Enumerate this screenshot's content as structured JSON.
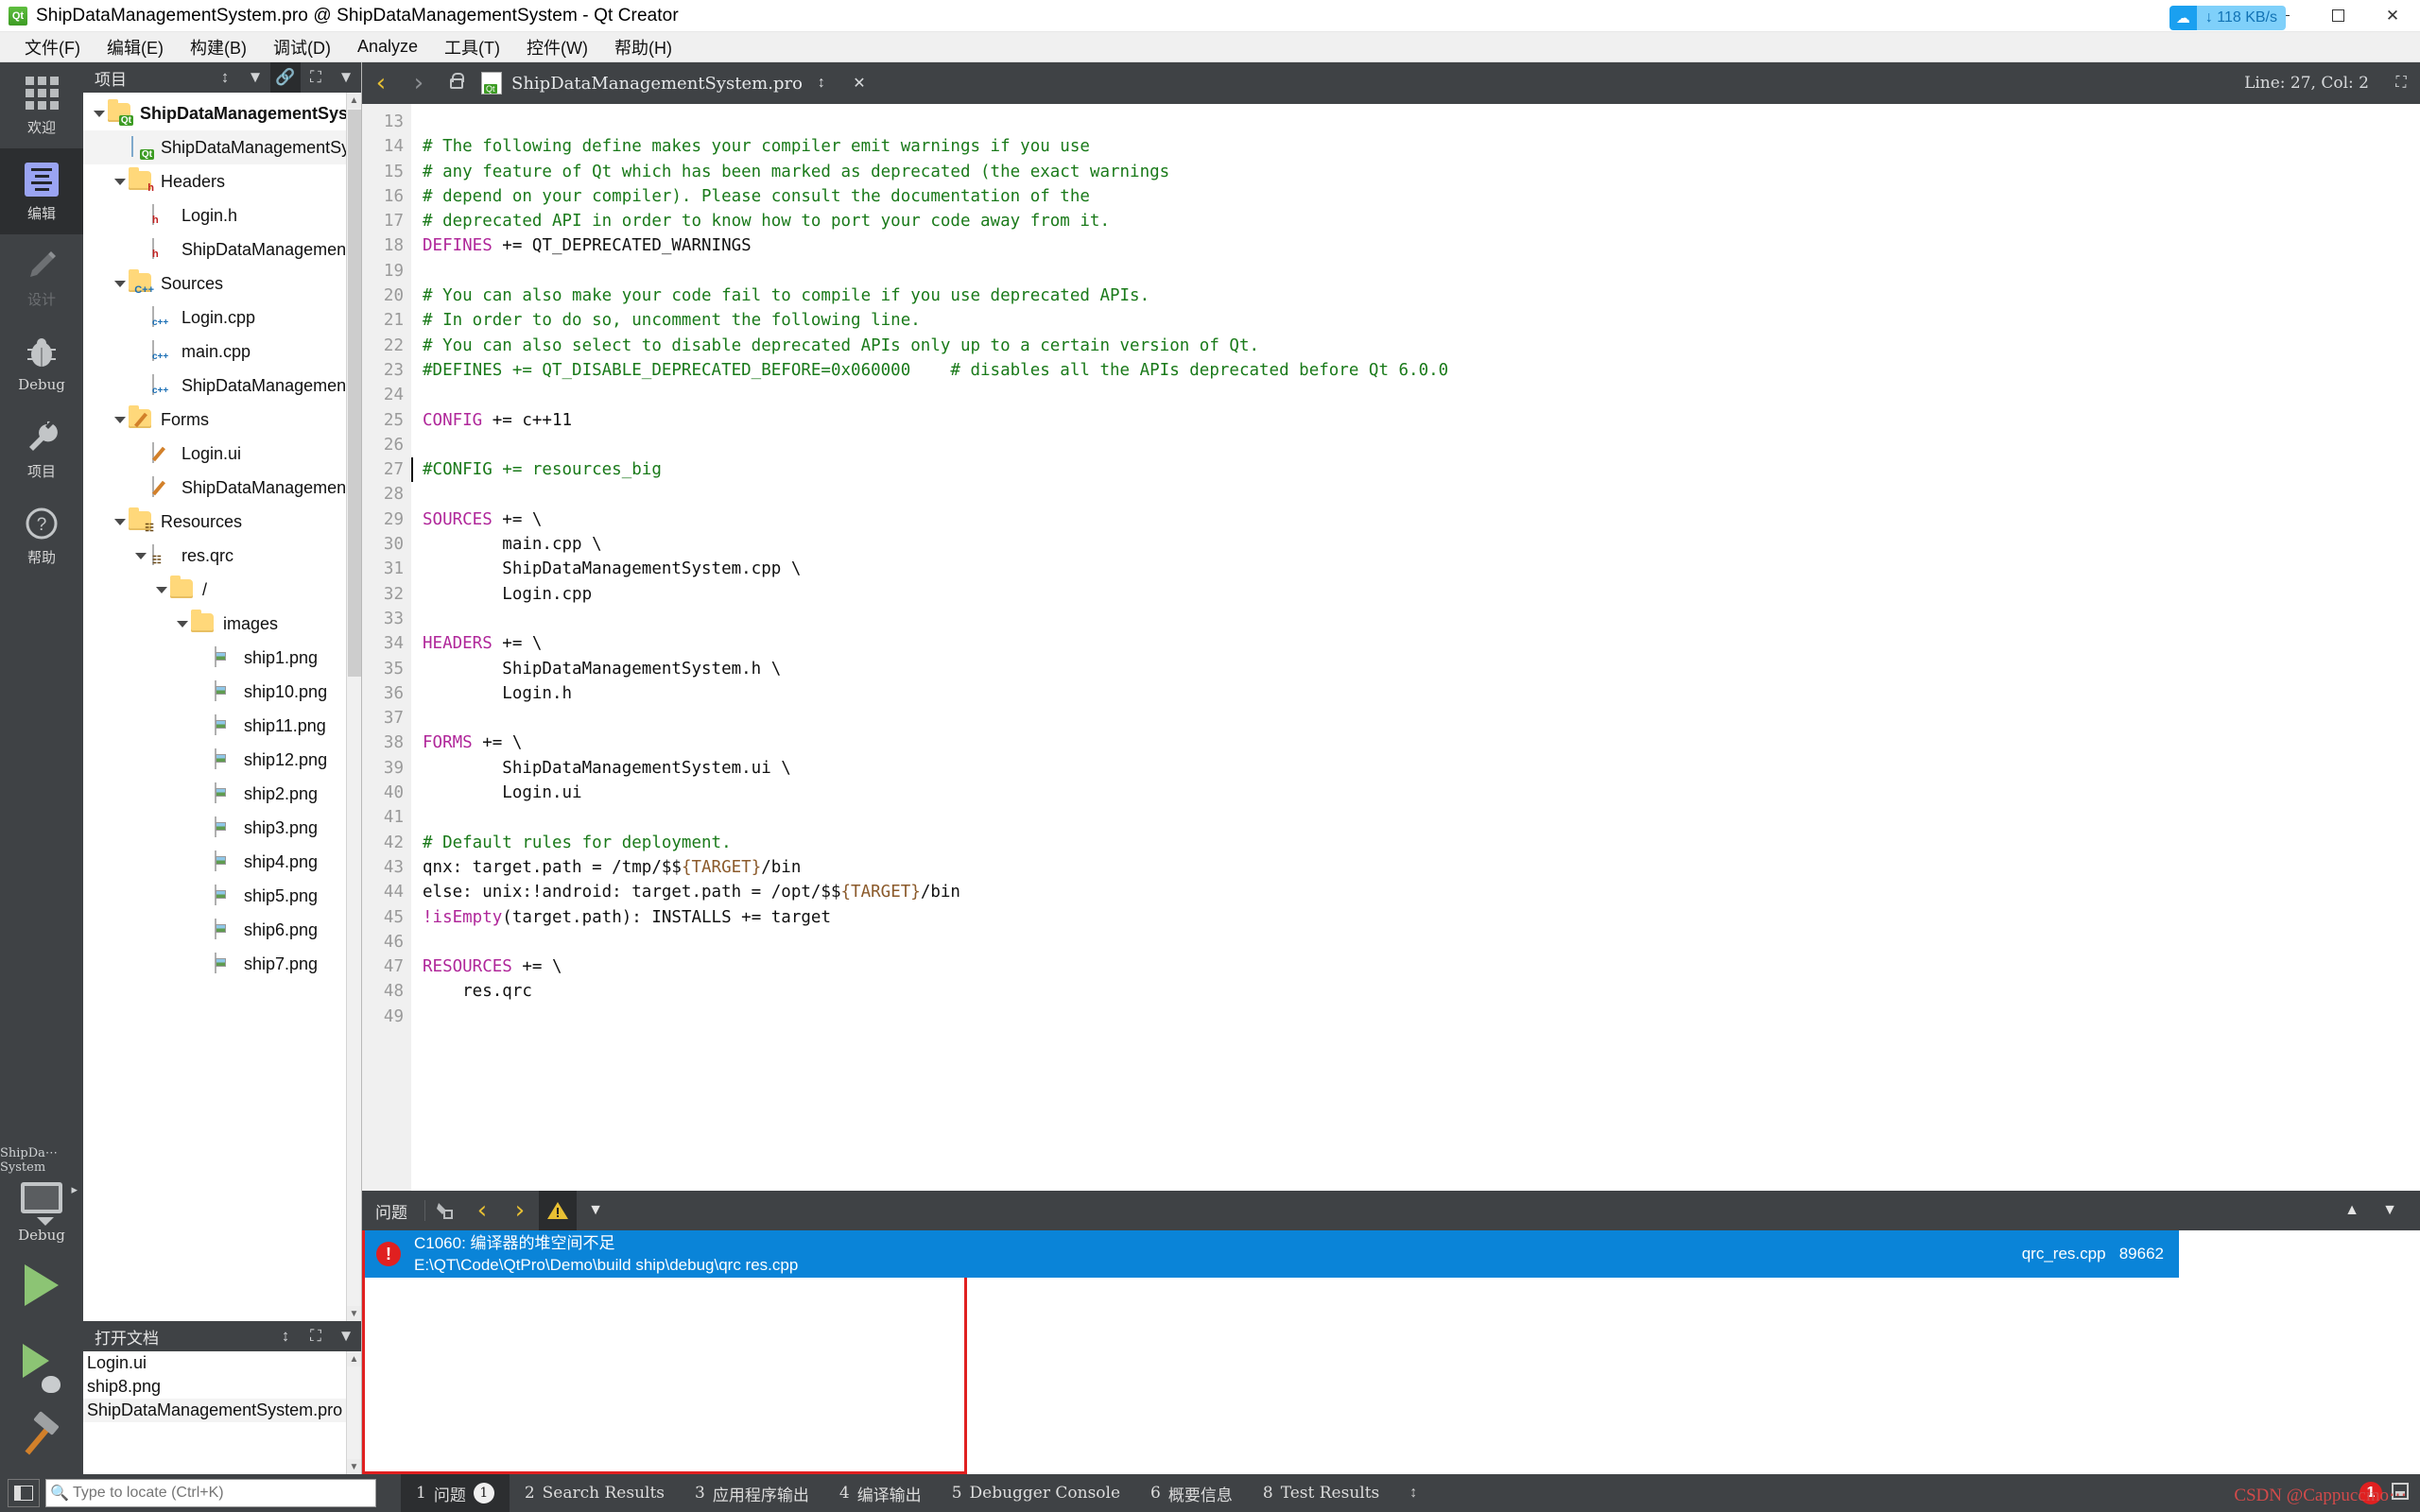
{
  "window": {
    "title": "ShipDataManagementSystem.pro @ ShipDataManagementSystem - Qt Creator",
    "app_icon": "qt-icon",
    "minimize": "–",
    "maximize": "▭",
    "close": "✕"
  },
  "menu": {
    "items": [
      "文件(F)",
      "编辑(E)",
      "构建(B)",
      "调试(D)",
      "Analyze",
      "工具(T)",
      "控件(W)",
      "帮助(H)"
    ]
  },
  "net_badge": {
    "icon": "cloud-icon",
    "speed": "↓ 118 KB/s"
  },
  "modebar": {
    "items": [
      {
        "label": "欢迎",
        "icon": "welcome-grid-icon",
        "state": "normal"
      },
      {
        "label": "编辑",
        "icon": "edit-lines-icon",
        "state": "active"
      },
      {
        "label": "设计",
        "icon": "design-pencil-icon",
        "state": "disabled"
      },
      {
        "label": "Debug",
        "icon": "debug-bug-icon",
        "state": "normal"
      },
      {
        "label": "项目",
        "icon": "projects-wrench-icon",
        "state": "normal"
      },
      {
        "label": "帮助",
        "icon": "help-question-icon",
        "state": "normal"
      }
    ],
    "kit": {
      "name": "ShipDa⋯System",
      "mode": "Debug",
      "icon": "monitor-icon"
    },
    "run": "run-play-button",
    "debug": "debug-play-button",
    "build": "build-hammer-button"
  },
  "project_dock": {
    "title": "项目",
    "tools": [
      "sync-icon",
      "filter-icon",
      "link-icon",
      "split-icon",
      "close-dock-icon"
    ],
    "tree": [
      {
        "label": "ShipDataManagementSystem",
        "icon": "qt-project-folder-icon",
        "indent": 0,
        "expanded": true,
        "bold": true
      },
      {
        "label": "ShipDataManagementSystem.pro",
        "icon": "qt-pro-file-icon",
        "indent": 1,
        "selected": true
      },
      {
        "label": "Headers",
        "icon": "headers-folder-icon",
        "indent": 1,
        "expanded": true
      },
      {
        "label": "Login.h",
        "icon": "h-file-icon",
        "indent": 2
      },
      {
        "label": "ShipDataManagementSystem.h",
        "icon": "h-file-icon",
        "indent": 2
      },
      {
        "label": "Sources",
        "icon": "sources-folder-icon",
        "indent": 1,
        "expanded": true
      },
      {
        "label": "Login.cpp",
        "icon": "cpp-file-icon",
        "indent": 2
      },
      {
        "label": "main.cpp",
        "icon": "cpp-file-icon",
        "indent": 2
      },
      {
        "label": "ShipDataManagementSystem.cpp",
        "icon": "cpp-file-icon",
        "indent": 2
      },
      {
        "label": "Forms",
        "icon": "forms-folder-icon",
        "indent": 1,
        "expanded": true
      },
      {
        "label": "Login.ui",
        "icon": "ui-file-icon",
        "indent": 2
      },
      {
        "label": "ShipDataManagementSystem.ui",
        "icon": "ui-file-icon",
        "indent": 2
      },
      {
        "label": "Resources",
        "icon": "resources-folder-icon",
        "indent": 1,
        "expanded": true
      },
      {
        "label": "res.qrc",
        "icon": "qrc-file-icon",
        "indent": 2,
        "expanded": true
      },
      {
        "label": "/",
        "icon": "plain-folder-icon",
        "indent": 3,
        "expanded": true
      },
      {
        "label": "images",
        "icon": "plain-folder-icon",
        "indent": 4,
        "expanded": true
      },
      {
        "label": "ship1.png",
        "icon": "image-file-icon",
        "indent": 5
      },
      {
        "label": "ship10.png",
        "icon": "image-file-icon",
        "indent": 5
      },
      {
        "label": "ship11.png",
        "icon": "image-file-icon",
        "indent": 5
      },
      {
        "label": "ship12.png",
        "icon": "image-file-icon",
        "indent": 5
      },
      {
        "label": "ship2.png",
        "icon": "image-file-icon",
        "indent": 5
      },
      {
        "label": "ship3.png",
        "icon": "image-file-icon",
        "indent": 5
      },
      {
        "label": "ship4.png",
        "icon": "image-file-icon",
        "indent": 5
      },
      {
        "label": "ship5.png",
        "icon": "image-file-icon",
        "indent": 5
      },
      {
        "label": "ship6.png",
        "icon": "image-file-icon",
        "indent": 5
      },
      {
        "label": "ship7.png",
        "icon": "image-file-icon",
        "indent": 5
      }
    ]
  },
  "opendocs_dock": {
    "title": "打开文档",
    "tools": [
      "sync-icon",
      "split-icon",
      "close-dock-icon"
    ],
    "items": [
      {
        "label": "Login.ui"
      },
      {
        "label": "ship8.png"
      },
      {
        "label": "ShipDataManagementSystem.pro",
        "selected": true
      }
    ]
  },
  "editor_toolbar": {
    "back": "‹",
    "forward": "›",
    "lock": "unlock-icon",
    "file_icon": "qt-pro-file-icon",
    "filename": "ShipDataManagementSystem.pro",
    "dropdown": "chevron-updown-icon",
    "close": "✕",
    "linecol": "Line: 27, Col: 2",
    "split": "split-icon"
  },
  "code": {
    "first_line": 13,
    "cursor_line": 27,
    "lines": [
      {
        "n": 13,
        "tokens": []
      },
      {
        "n": 14,
        "tokens": [
          [
            "cmt",
            "# The following define makes your compiler emit warnings if you use"
          ]
        ]
      },
      {
        "n": 15,
        "tokens": [
          [
            "cmt",
            "# any feature of Qt which has been marked as deprecated (the exact warnings"
          ]
        ]
      },
      {
        "n": 16,
        "tokens": [
          [
            "cmt",
            "# depend on your compiler). Please consult the documentation of the"
          ]
        ]
      },
      {
        "n": 17,
        "tokens": [
          [
            "cmt",
            "# deprecated API in order to know how to port your code away from it."
          ]
        ]
      },
      {
        "n": 18,
        "tokens": [
          [
            "kw",
            "DEFINES"
          ],
          [
            "txt",
            " += QT_DEPRECATED_WARNINGS"
          ]
        ]
      },
      {
        "n": 19,
        "tokens": []
      },
      {
        "n": 20,
        "tokens": [
          [
            "cmt",
            "# You can also make your code fail to compile if you use deprecated APIs."
          ]
        ]
      },
      {
        "n": 21,
        "tokens": [
          [
            "cmt",
            "# In order to do so, uncomment the following line."
          ]
        ]
      },
      {
        "n": 22,
        "tokens": [
          [
            "cmt",
            "# You can also select to disable deprecated APIs only up to a certain version of Qt."
          ]
        ]
      },
      {
        "n": 23,
        "tokens": [
          [
            "cmt",
            "#DEFINES += QT_DISABLE_DEPRECATED_BEFORE=0x060000    # disables all the APIs deprecated before Qt 6.0.0"
          ]
        ]
      },
      {
        "n": 24,
        "tokens": []
      },
      {
        "n": 25,
        "tokens": [
          [
            "kw",
            "CONFIG"
          ],
          [
            "txt",
            " += c++11"
          ]
        ]
      },
      {
        "n": 26,
        "tokens": []
      },
      {
        "n": 27,
        "tokens": [
          [
            "cmt",
            "#CONFIG += resources_big"
          ]
        ]
      },
      {
        "n": 28,
        "tokens": []
      },
      {
        "n": 29,
        "tokens": [
          [
            "kw",
            "SOURCES"
          ],
          [
            "txt",
            " += \\"
          ]
        ]
      },
      {
        "n": 30,
        "tokens": [
          [
            "txt",
            "        main.cpp \\"
          ]
        ]
      },
      {
        "n": 31,
        "tokens": [
          [
            "txt",
            "        ShipDataManagementSystem.cpp \\"
          ]
        ]
      },
      {
        "n": 32,
        "tokens": [
          [
            "txt",
            "        Login.cpp"
          ]
        ]
      },
      {
        "n": 33,
        "tokens": []
      },
      {
        "n": 34,
        "tokens": [
          [
            "kw",
            "HEADERS"
          ],
          [
            "txt",
            " += \\"
          ]
        ]
      },
      {
        "n": 35,
        "tokens": [
          [
            "txt",
            "        ShipDataManagementSystem.h \\"
          ]
        ]
      },
      {
        "n": 36,
        "tokens": [
          [
            "txt",
            "        Login.h"
          ]
        ]
      },
      {
        "n": 37,
        "tokens": []
      },
      {
        "n": 38,
        "tokens": [
          [
            "kw",
            "FORMS"
          ],
          [
            "txt",
            " += \\"
          ]
        ]
      },
      {
        "n": 39,
        "tokens": [
          [
            "txt",
            "        ShipDataManagementSystem.ui \\"
          ]
        ]
      },
      {
        "n": 40,
        "tokens": [
          [
            "txt",
            "        Login.ui"
          ]
        ]
      },
      {
        "n": 41,
        "tokens": []
      },
      {
        "n": 42,
        "tokens": [
          [
            "cmt",
            "# Default rules for deployment."
          ]
        ]
      },
      {
        "n": 43,
        "tokens": [
          [
            "txt",
            "qnx: target.path = /tmp/$$"
          ],
          [
            "var",
            "{TARGET}"
          ],
          [
            "txt",
            "/bin"
          ]
        ]
      },
      {
        "n": 44,
        "tokens": [
          [
            "txt",
            "else: unix:!android: target.path = /opt/$$"
          ],
          [
            "var",
            "{TARGET}"
          ],
          [
            "txt",
            "/bin"
          ]
        ]
      },
      {
        "n": 45,
        "tokens": [
          [
            "kw",
            "!isEmpty"
          ],
          [
            "txt",
            "(target.path): INSTALLS += target"
          ]
        ]
      },
      {
        "n": 46,
        "tokens": []
      },
      {
        "n": 47,
        "tokens": [
          [
            "kw",
            "RESOURCES"
          ],
          [
            "txt",
            " += \\"
          ]
        ]
      },
      {
        "n": 48,
        "tokens": [
          [
            "txt",
            "    res.qrc"
          ]
        ]
      },
      {
        "n": 49,
        "tokens": []
      }
    ]
  },
  "issues_pane": {
    "title": "问题",
    "tools": [
      "clear-icon",
      "prev-issue-icon",
      "next-issue-icon",
      "warning-filter-icon",
      "filter-icon"
    ],
    "collapse": "chevron-up-icon",
    "maximize": "maximize-pane-icon",
    "rows": [
      {
        "severity": "error",
        "message": "C1060: 编译器的堆空间不足",
        "location": "E:\\QT\\Code\\QtPro\\Demo\\build ship\\debug\\qrc res.cpp",
        "file": "qrc_res.cpp",
        "line": "89662"
      }
    ]
  },
  "statusbar": {
    "sidebar_toggle": "toggle-sidebar-icon",
    "locator_icon": "search-icon",
    "locator_placeholder": "Type to locate (Ctrl+K)",
    "tabs": [
      {
        "num": "1",
        "label": "问题",
        "badge": "1",
        "active": true
      },
      {
        "num": "2",
        "label": "Search Results"
      },
      {
        "num": "3",
        "label": "应用程序输出"
      },
      {
        "num": "4",
        "label": "编译输出"
      },
      {
        "num": "5",
        "label": "Debugger Console"
      },
      {
        "num": "6",
        "label": "概要信息"
      },
      {
        "num": "8",
        "label": "Test Results"
      }
    ],
    "updown": "chevron-updown-icon",
    "error_count": "1",
    "warn_count": "",
    "progress_icon": "progress-icon"
  },
  "watermark": "CSDN @Cappuccino⋯",
  "colors": {
    "accent_blue": "#0a84d8",
    "error_red": "#e02020",
    "dark_chrome": "#3f4245",
    "comment_green": "#1a7a1a",
    "keyword_magenta": "#b0279a"
  }
}
